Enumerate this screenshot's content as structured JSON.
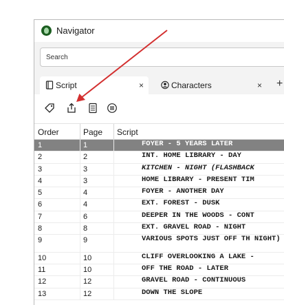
{
  "window": {
    "title": "Navigator"
  },
  "search": {
    "placeholder": "Search"
  },
  "tabs": [
    {
      "label": "Script",
      "close": "×"
    },
    {
      "label": "Characters",
      "close": "×"
    }
  ],
  "tab_add": "+",
  "toolbar": {
    "tools": [
      "tag-icon",
      "share-icon",
      "notes-icon",
      "list-icon"
    ]
  },
  "grid": {
    "columns": [
      "Order",
      "Page",
      "Script"
    ],
    "rows": [
      {
        "order": "1",
        "page": "1",
        "script": "FOYER - 5 YEARS LATER"
      },
      {
        "order": "2",
        "page": "2",
        "script": "INT. HOME LIBRARY - DAY"
      },
      {
        "order": "3",
        "page": "3",
        "script": "KITCHEN - NIGHT (FLASHBACK"
      },
      {
        "order": "4",
        "page": "3",
        "script": "HOME LIBRARY - PRESENT TIM"
      },
      {
        "order": "5",
        "page": "4",
        "script": "FOYER - ANOTHER DAY"
      },
      {
        "order": "6",
        "page": "4",
        "script": "EXT. FOREST - DUSK"
      },
      {
        "order": "7",
        "page": "6",
        "script": "DEEPER IN THE WOODS - CONT"
      },
      {
        "order": "8",
        "page": "8",
        "script": "EXT. GRAVEL ROAD - NIGHT"
      },
      {
        "order": "9",
        "page": "9",
        "script": "VARIOUS SPOTS JUST OFF TH NIGHT)"
      },
      {
        "order": "10",
        "page": "10",
        "script": "CLIFF OVERLOOKING A LAKE -"
      },
      {
        "order": "11",
        "page": "10",
        "script": "OFF THE ROAD - LATER"
      },
      {
        "order": "12",
        "page": "12",
        "script": "GRAVEL ROAD - CONTINUOUS"
      },
      {
        "order": "13",
        "page": "12",
        "script": "DOWN THE SLOPE"
      }
    ]
  },
  "colors": {
    "selected_row": "#828282",
    "annotation_arrow": "#d32f2f"
  }
}
